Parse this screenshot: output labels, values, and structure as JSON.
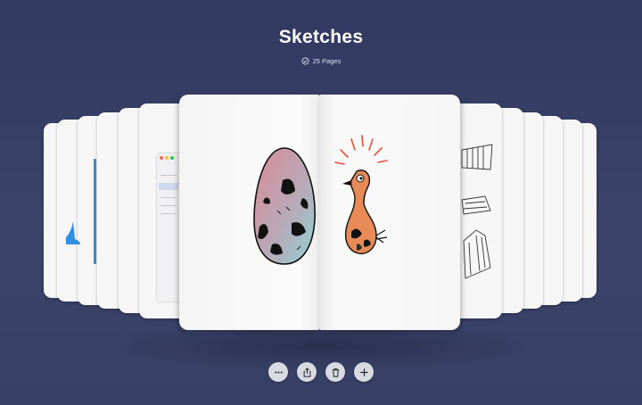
{
  "header": {
    "title": "Sketches",
    "page_count_label": "25 Pages",
    "page_count_icon": "checkmark-circle-icon"
  },
  "toolbar": {
    "buttons": [
      {
        "icon": "ellipsis-icon"
      },
      {
        "icon": "share-icon"
      },
      {
        "icon": "trash-icon"
      },
      {
        "icon": "plus-icon"
      }
    ]
  },
  "colors": {
    "background": "#353d63",
    "page": "#f6f6f7",
    "egg_pink": "#d88b98",
    "egg_teal": "#8fd1d3",
    "bird_orange": "#e88a55",
    "burst_red": "#e8503a",
    "accent_blue": "#2f8fe0"
  }
}
